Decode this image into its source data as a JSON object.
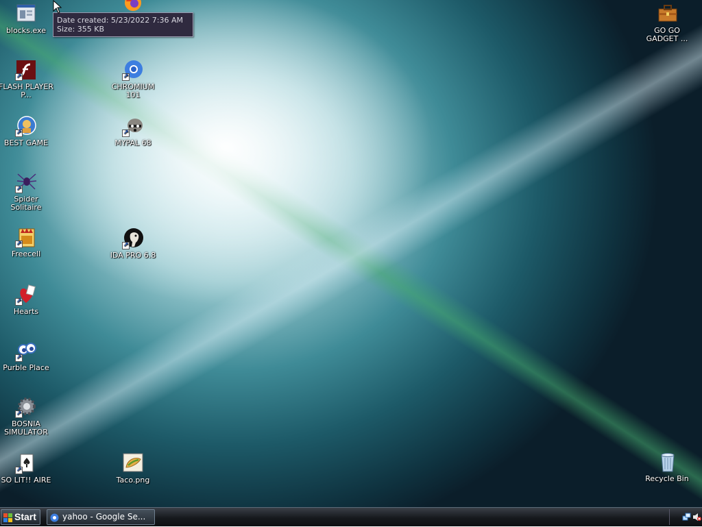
{
  "desktop": {
    "icons": [
      {
        "id": "blocks",
        "label": "blocks.exe"
      },
      {
        "id": "flash",
        "label": "FLASH PLAYER P..."
      },
      {
        "id": "bestgame",
        "label": "BEST GAME"
      },
      {
        "id": "spider",
        "label": "Spider Solitaire"
      },
      {
        "id": "freecell",
        "label": "Freecell"
      },
      {
        "id": "hearts",
        "label": "Hearts"
      },
      {
        "id": "purble",
        "label": "Purble Place"
      },
      {
        "id": "bosnia",
        "label": "BOSNIA SIMULATOR"
      },
      {
        "id": "solitaire",
        "label": "SO LIT!! AIRE"
      },
      {
        "id": "firefox",
        "label": ""
      },
      {
        "id": "chromium",
        "label": "CHROMIUM 101"
      },
      {
        "id": "mypal",
        "label": "MYPAL 68"
      },
      {
        "id": "idapro",
        "label": "IDA PRO 6.8"
      },
      {
        "id": "taco",
        "label": "Taco.png"
      },
      {
        "id": "gogo",
        "label": "GO GO GADGET ..."
      },
      {
        "id": "recycle",
        "label": "Recycle Bin"
      }
    ]
  },
  "tooltip": {
    "line1": "Date created: 5/23/2022 7:36 AM",
    "line2": "Size: 355 KB"
  },
  "taskbar": {
    "start_label": "Start",
    "task_label": "yahoo - Google Se..."
  },
  "icons": {
    "tooltip_target": "blocks.exe",
    "tray": [
      "network-icon",
      "volume-muted-icon"
    ]
  }
}
